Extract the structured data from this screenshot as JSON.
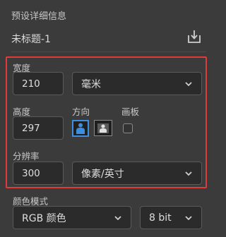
{
  "panel": {
    "section_title": "预设详细信息",
    "document_name": "未标题-1"
  },
  "size": {
    "width_label": "宽度",
    "width_value": "210",
    "unit_value": "毫米",
    "height_label": "高度",
    "height_value": "297",
    "orientation_label": "方向",
    "artboard_label": "画板"
  },
  "resolution": {
    "label": "分辨率",
    "value": "300",
    "unit_value": "像素/英寸"
  },
  "color": {
    "label": "颜色模式",
    "mode_value": "RGB 颜色",
    "depth_value": "8 bit"
  },
  "style": {
    "accent": "#3c8ee0",
    "highlight_frame": "#e03a3a"
  }
}
